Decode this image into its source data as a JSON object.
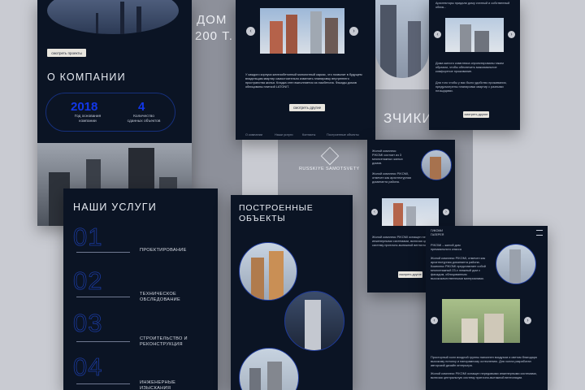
{
  "colors": {
    "bg": "#c9cbd2",
    "screen": "#0b1424",
    "accent": "#1237e8",
    "button": "#e9e6df"
  },
  "about": {
    "projects_button": "смотреть проекты",
    "title": "О КОМПАНИИ",
    "year_value": "2018",
    "year_caption": "Год основания компании",
    "objects_value": "4",
    "objects_caption": "Количество сданных объектов"
  },
  "hero_bg": {
    "line1": "ДОМ",
    "line2": "200 Т."
  },
  "project": {
    "description": "У каждого корпуса железобетонный монолитный каркас, что позволит в будущем владельцам квартир самостоятельно изменить планировку внутреннего пространства жилья. Кладка стен выполняется из газобетона. Фасады домов облицованы плиткой LATONIT.",
    "more_button": "смотреть другие",
    "nav": [
      "О компании",
      "Наши услуги",
      "Контакты",
      "Построенные объекты"
    ],
    "arrow_prev": "‹",
    "arrow_next": "›"
  },
  "partners_bg": {
    "title": "ЗЧИКИ",
    "logo_text": "RUSSKIYE SAMOTSVETY"
  },
  "right_top": {
    "text1": "Архитекторы придали дому статный и собственный облик...",
    "text2": "Дома жилого комплекса спроектированы таким образом, чтобы обеспечить максимальное комфортное проживание.",
    "text3": "Для того чтобы у вас было удобство проживания, предусмотрены планировки квартир с разными площадями.",
    "more_button": "смотреть другие"
  },
  "services": {
    "title": "НАШИ УСЛУГИ",
    "items": [
      {
        "num": "01",
        "label": "ПРОЕКТИРОВАНИЕ"
      },
      {
        "num": "02",
        "label": "ТЕХНИЧЕСКОЕ ОБСЛЕДОВАНИЕ"
      },
      {
        "num": "03",
        "label": "СТРОИТЕЛЬСТВО И РЕКОНСТРУКЦИЯ"
      },
      {
        "num": "04",
        "label": "ИНЖЕНЕРНЫЕ ИЗЫСКАНИЯ"
      }
    ]
  },
  "built": {
    "title": "ПОСТРОЕННЫЕ ОБЪЕКТЫ"
  },
  "mobile_mid": {
    "text1": "Жилой комплекс PIKOMI состоит из 3 многоэтажных жилых домов.",
    "text2": "Жилой комплекс PIKOMI, отмечен как архитектурная доминанта района.",
    "more_button": "смотреть другие"
  },
  "mobile_right": {
    "logo": "ГИКОМИ ГАЛЕРЕЯ",
    "intro": "PIKOMI – жилой дом премиального класса",
    "text1": "Жилой комплекс PIKOMI, отмечен как архитектурная доминанта района. Комплекс PIKOMI представляет собой многоэтажный 23-х этажный дом с фасадом, облицованным высококачественными материалами.",
    "text2": "Просторный холл входной группы наполнен воздухом и светом благодаря высокому потолку и панорамному остеклению. Для холла разработан авторский дизайн интерьера.",
    "text3": "Жилой комплекс PIKOMI оснащен передовыми инженерными системами, включая центральную систему приточно-вытяжной вентиляции."
  }
}
